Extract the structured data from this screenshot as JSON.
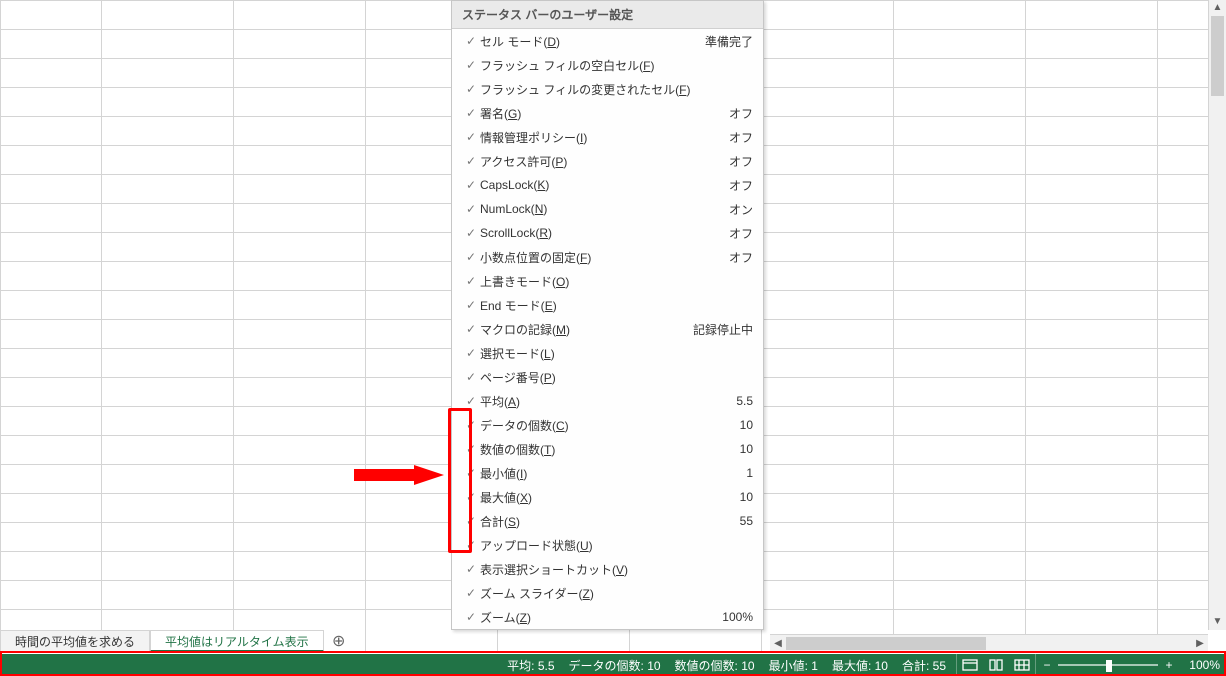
{
  "sheet_tabs": {
    "tab1": "時間の平均値を求める",
    "tab2": "平均値はリアルタイム表示"
  },
  "menu": {
    "title": "ステータス バーのユーザー設定",
    "items": [
      {
        "label_pre": "セル モード(",
        "ul": "D",
        "label_post": ")",
        "status": "準備完了"
      },
      {
        "label_pre": "フラッシュ フィルの空白セル(",
        "ul": "F",
        "label_post": ")",
        "status": ""
      },
      {
        "label_pre": "フラッシュ フィルの変更されたセル(",
        "ul": "F",
        "label_post": ")",
        "status": ""
      },
      {
        "label_pre": "署名(",
        "ul": "G",
        "label_post": ")",
        "status": "オフ"
      },
      {
        "label_pre": "情報管理ポリシー(",
        "ul": "I",
        "label_post": ")",
        "status": "オフ"
      },
      {
        "label_pre": "アクセス許可(",
        "ul": "P",
        "label_post": ")",
        "status": "オフ"
      },
      {
        "label_pre": "CapsLock(",
        "ul": "K",
        "label_post": ")",
        "status": "オフ"
      },
      {
        "label_pre": "NumLock(",
        "ul": "N",
        "label_post": ")",
        "status": "オン"
      },
      {
        "label_pre": "ScrollLock(",
        "ul": "R",
        "label_post": ")",
        "status": "オフ"
      },
      {
        "label_pre": "小数点位置の固定(",
        "ul": "F",
        "label_post": ")",
        "status": "オフ"
      },
      {
        "label_pre": "上書きモード(",
        "ul": "O",
        "label_post": ")",
        "status": ""
      },
      {
        "label_pre": "End モード(",
        "ul": "E",
        "label_post": ")",
        "status": ""
      },
      {
        "label_pre": "マクロの記録(",
        "ul": "M",
        "label_post": ")",
        "status": "記録停止中"
      },
      {
        "label_pre": "選択モード(",
        "ul": "L",
        "label_post": ")",
        "status": ""
      },
      {
        "label_pre": "ページ番号(",
        "ul": "P",
        "label_post": ")",
        "status": ""
      },
      {
        "label_pre": "平均(",
        "ul": "A",
        "label_post": ")",
        "status": "5.5"
      },
      {
        "label_pre": "データの個数(",
        "ul": "C",
        "label_post": ")",
        "status": "10"
      },
      {
        "label_pre": "数値の個数(",
        "ul": "T",
        "label_post": ")",
        "status": "10"
      },
      {
        "label_pre": "最小値(",
        "ul": "I",
        "label_post": ")",
        "status": "1"
      },
      {
        "label_pre": "最大値(",
        "ul": "X",
        "label_post": ")",
        "status": "10"
      },
      {
        "label_pre": "合計(",
        "ul": "S",
        "label_post": ")",
        "status": "55"
      },
      {
        "label_pre": "アップロード状態(",
        "ul": "U",
        "label_post": ")",
        "status": ""
      },
      {
        "label_pre": "表示選択ショートカット(",
        "ul": "V",
        "label_post": ")",
        "status": ""
      },
      {
        "label_pre": "ズーム スライダー(",
        "ul": "Z",
        "label_post": ")",
        "status": ""
      },
      {
        "label_pre": "ズーム(",
        "ul": "Z",
        "label_post": ")",
        "status": "100%"
      }
    ]
  },
  "statusbar": {
    "avg_lbl": "平均: ",
    "avg_val": "5.5",
    "count_lbl": "データの個数: ",
    "count_val": "10",
    "numcount_lbl": "数値の個数: ",
    "numcount_val": "10",
    "min_lbl": "最小値: ",
    "min_val": "1",
    "max_lbl": "最大値: ",
    "max_val": "10",
    "sum_lbl": "合計: ",
    "sum_val": "55",
    "zoom": "100%",
    "minus": "−",
    "plus": "+"
  }
}
